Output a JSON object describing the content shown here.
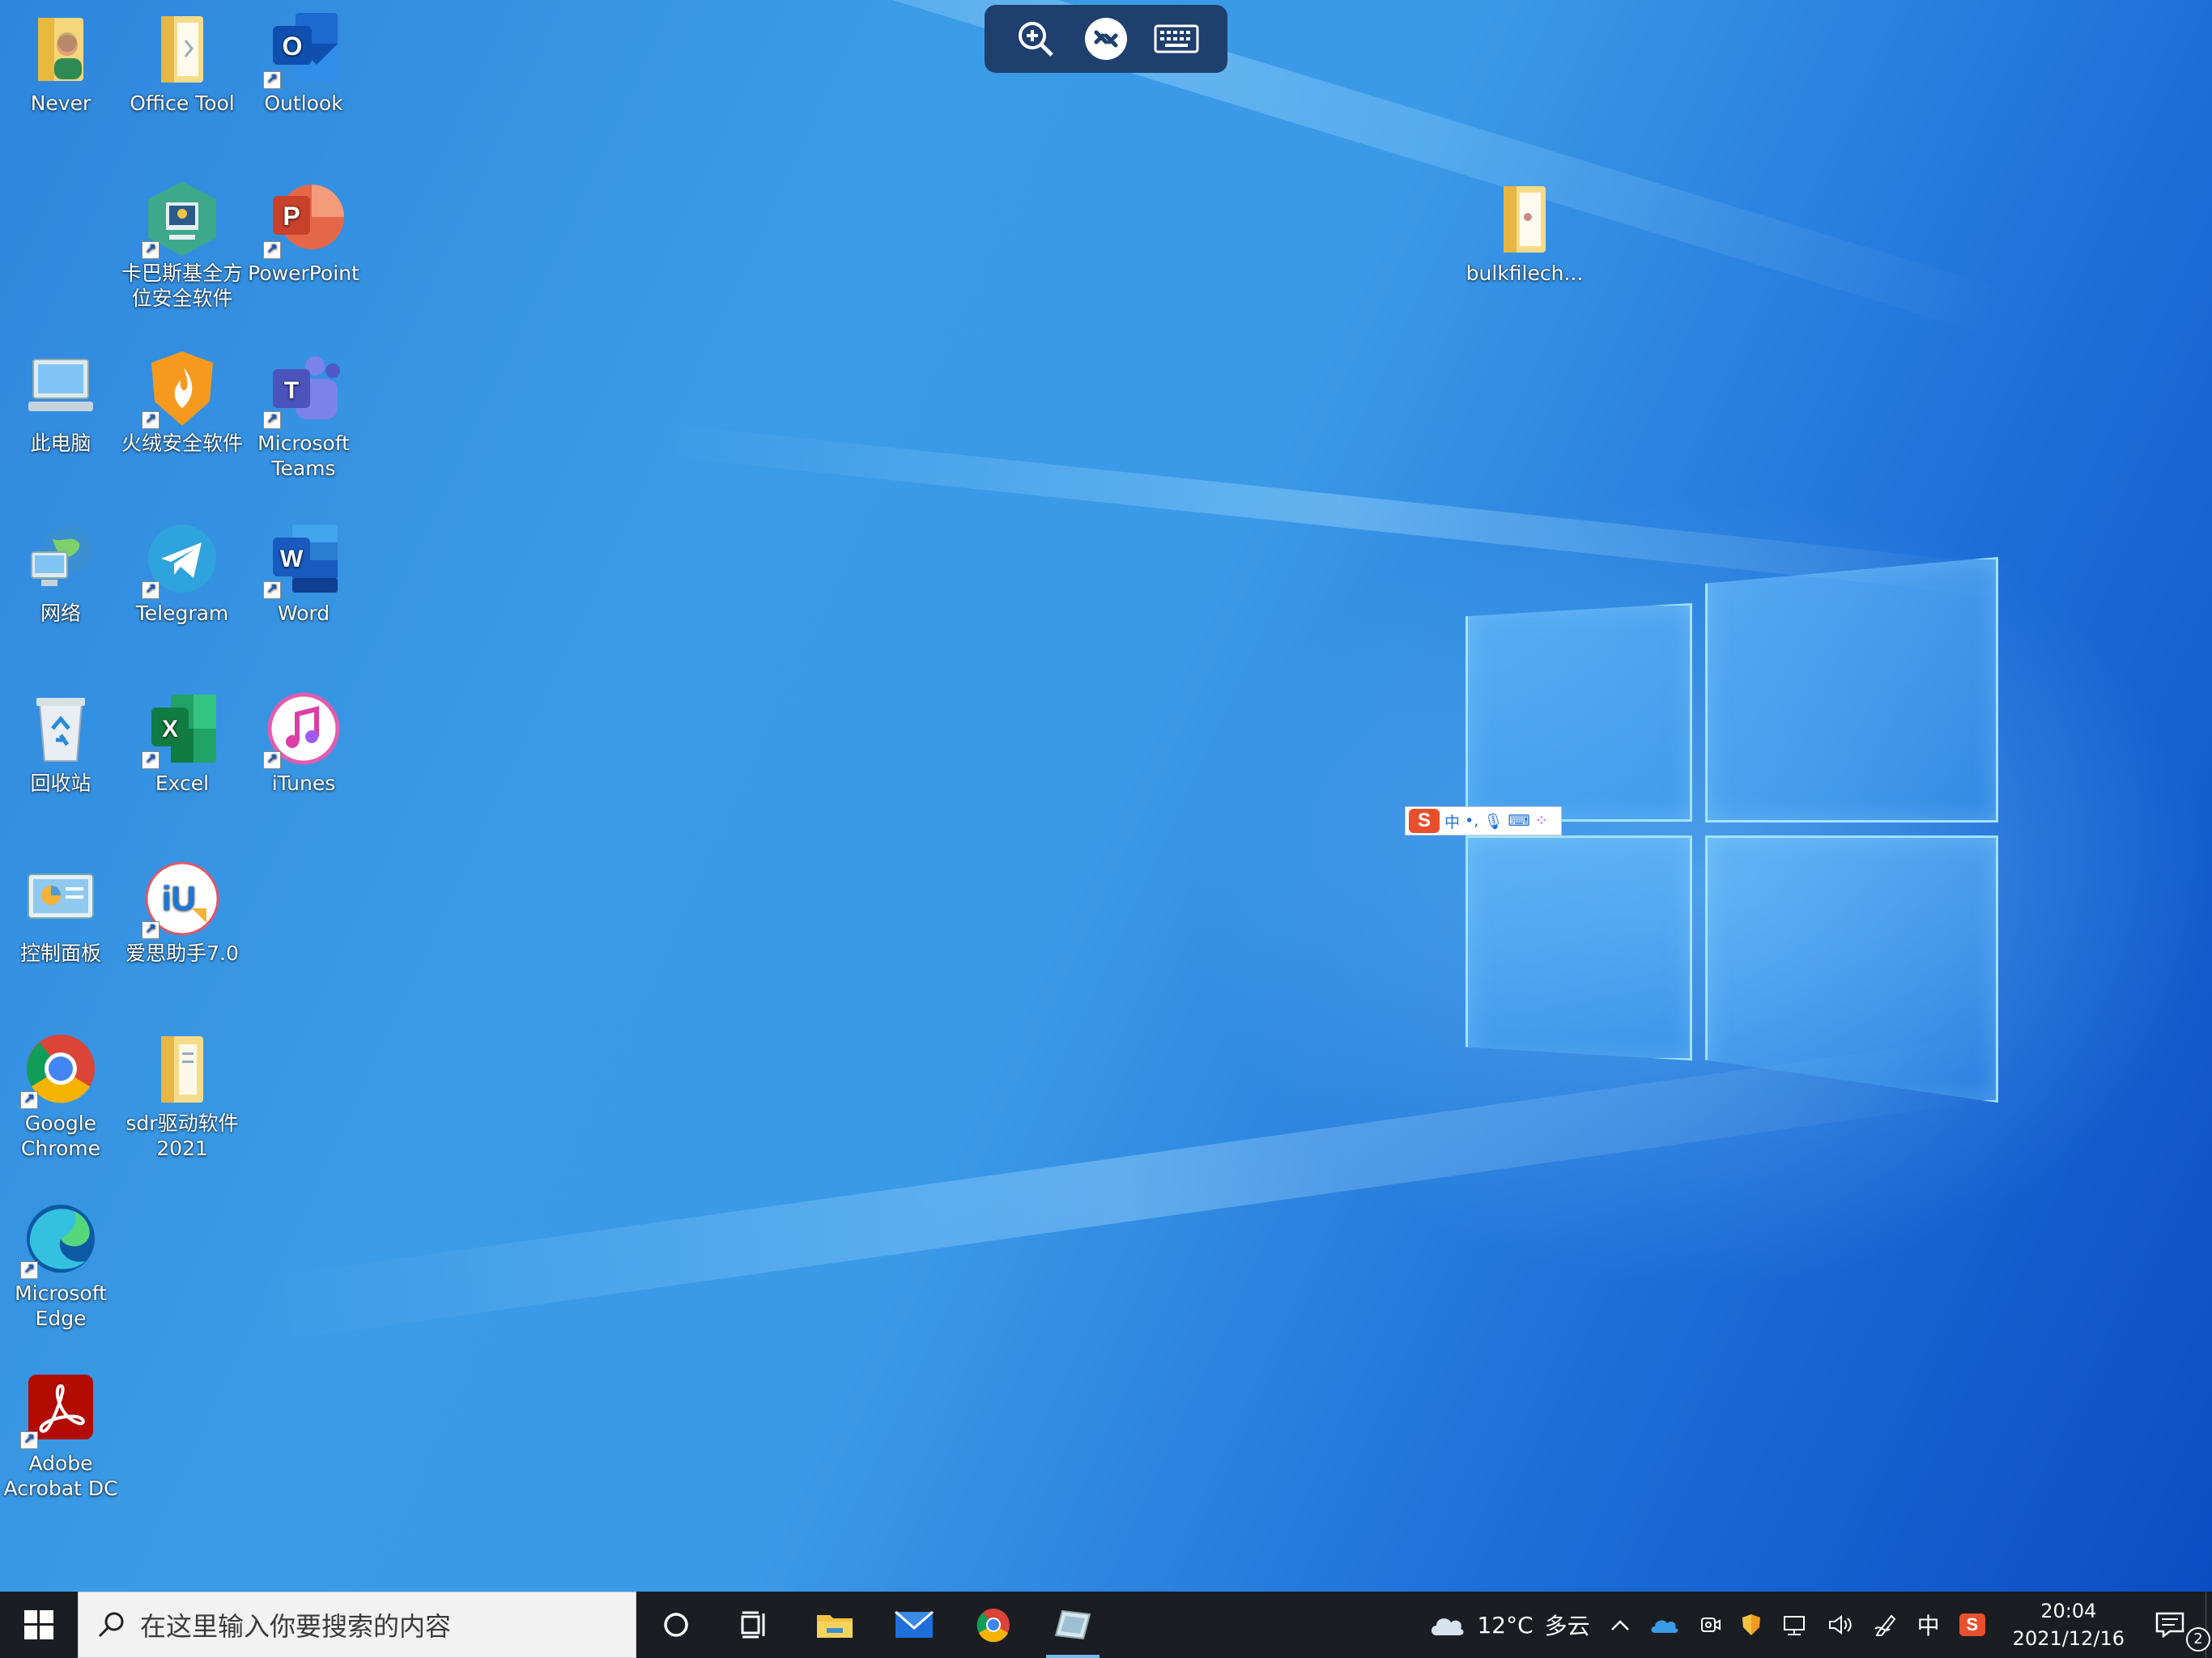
{
  "remote_toolbar": {
    "buttons": [
      "zoom-in",
      "remote-connection",
      "keyboard"
    ]
  },
  "desktop": {
    "icons": [
      {
        "label": "Never"
      },
      {
        "label": "Office Tool"
      },
      {
        "label": "Outlook"
      },
      {
        "label": "卡巴斯基全方\n位安全软件"
      },
      {
        "label": "PowerPoint"
      },
      {
        "label": "此电脑"
      },
      {
        "label": "火绒安全软件"
      },
      {
        "label": "Microsoft\nTeams"
      },
      {
        "label": "网络"
      },
      {
        "label": "Telegram"
      },
      {
        "label": "Word"
      },
      {
        "label": "回收站"
      },
      {
        "label": "Excel"
      },
      {
        "label": "iTunes"
      },
      {
        "label": "控制面板"
      },
      {
        "label": "爱思助手7.0"
      },
      {
        "label": "Google\nChrome"
      },
      {
        "label": "sdr驱动软件\n2021"
      },
      {
        "label": "Microsoft\nEdge"
      },
      {
        "label": "Adobe\nAcrobat DC"
      },
      {
        "label": "bulkfilech..."
      }
    ]
  },
  "ime": {
    "logo": "S",
    "mode": "中",
    "punct": "•,"
  },
  "taskbar": {
    "search_placeholder": "在这里输入你要搜索的内容",
    "pinned": [
      "cortana",
      "task-view",
      "file-explorer",
      "mail",
      "google-chrome",
      "active-app"
    ],
    "weather": {
      "temp": "12°C",
      "desc": "多云"
    },
    "input_lang": "中",
    "clock": {
      "time": "20:04",
      "date": "2021/12/16"
    },
    "notifications_count": "2"
  }
}
